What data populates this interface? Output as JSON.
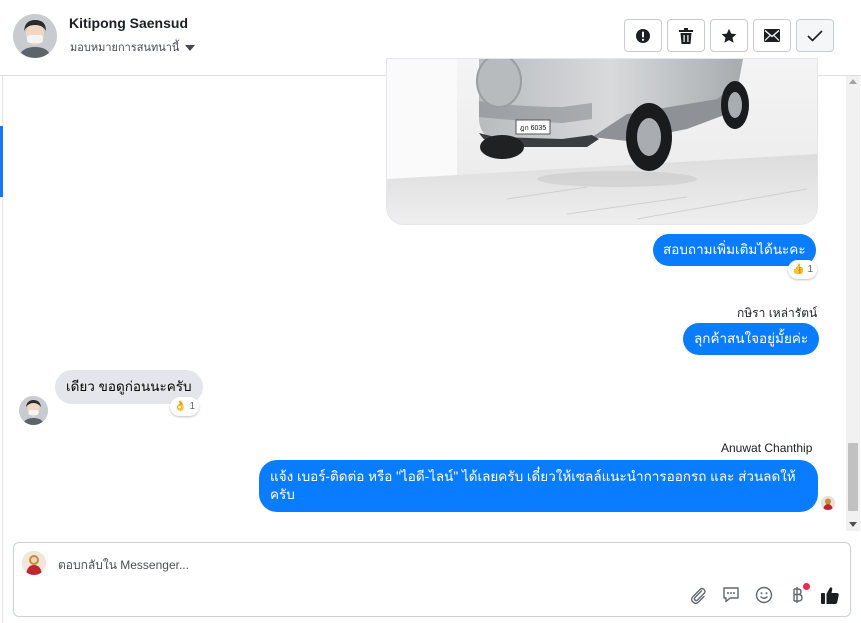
{
  "header": {
    "contact_name": "Kitipong Saensud",
    "assign_label": "มอบหมายการสนทนานี้",
    "actions": [
      {
        "name": "spam-button",
        "icon": "exclamation-icon"
      },
      {
        "name": "delete-button",
        "icon": "trash-icon"
      },
      {
        "name": "star-button",
        "icon": "star-icon"
      },
      {
        "name": "mark-unread-button",
        "icon": "envelope-icon"
      },
      {
        "name": "mark-done-button",
        "icon": "check-icon"
      }
    ]
  },
  "photo": {
    "plate": "ฎก 6035"
  },
  "messages": [
    {
      "id": "m1",
      "direction": "out",
      "text": "สอบถามเพิ่มเติมได้นะคะ",
      "reaction": {
        "emoji": "👍",
        "count": "1"
      }
    },
    {
      "id": "m2",
      "direction": "out",
      "sender": "กษิรา เหล่ารัตน์",
      "text": "ลุกค้าสนใจอยู่มั้ยค่ะ"
    },
    {
      "id": "m3",
      "direction": "in",
      "text": "เดียว ขอดูก่อนนะครับ",
      "reaction": {
        "emoji": "👌",
        "count": "1"
      }
    },
    {
      "id": "m4",
      "direction": "out",
      "sender": "Anuwat Chanthip",
      "text": "แจ้ง เบอร์-ติดต่อ หรือ \"ไอดี-ไลน์\" ได้เลยครับ เดี๋ยวให้เซลล์แนะนำการออกรถ และ ส่วนลดให้ครับ"
    }
  ],
  "composer": {
    "placeholder": "ตอบกลับใน Messenger...",
    "tools": [
      "paperclip-icon",
      "saved-reply-icon",
      "emoji-icon",
      "currency-icon",
      "like-icon"
    ]
  },
  "colors": {
    "accent": "#0a7cff",
    "incoming": "#e4e6eb",
    "badge": "#f02849"
  }
}
